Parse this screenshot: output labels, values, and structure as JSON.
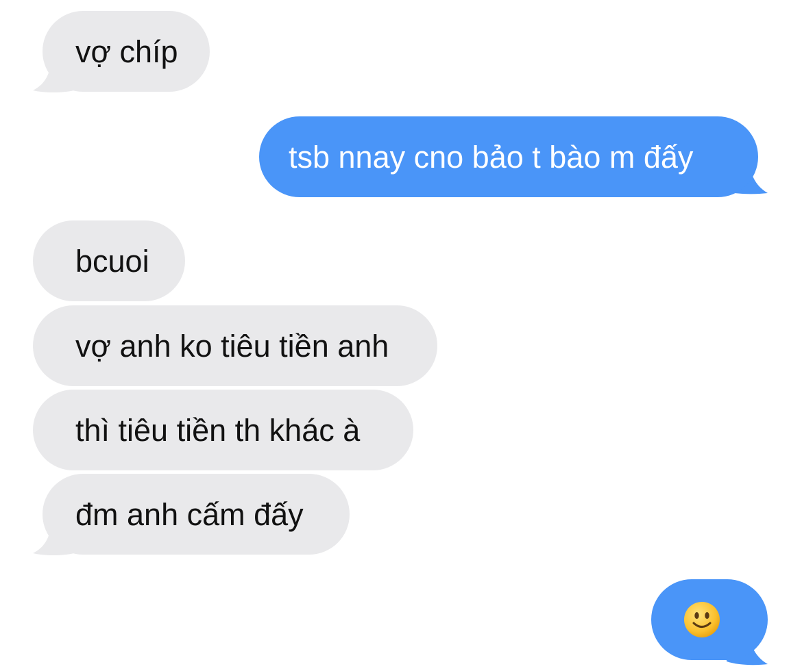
{
  "messages": [
    {
      "direction": "received",
      "text": "vợ chíp"
    },
    {
      "direction": "sent",
      "text": "tsb nnay cno bảo t bào m đấy"
    },
    {
      "direction": "received",
      "text": "bcuoi"
    },
    {
      "direction": "received",
      "text": "vợ anh ko tiêu tiền anh"
    },
    {
      "direction": "received",
      "text": "thì tiêu tiền th khác à"
    },
    {
      "direction": "received",
      "text": "đm anh cấm đấy"
    },
    {
      "direction": "sent",
      "emoji": "slightly-smiling-face"
    }
  ],
  "colors": {
    "received_bubble": "#e9e9eb",
    "sent_bubble": "#4a95f8",
    "received_text": "#111111",
    "sent_text": "#ffffff",
    "background": "#ffffff"
  }
}
